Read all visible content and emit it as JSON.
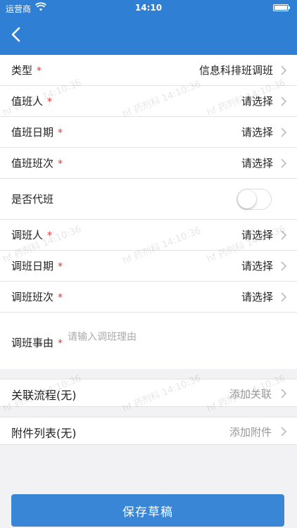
{
  "status_bar": {
    "carrier": "运营商",
    "time": "14:10"
  },
  "form": {
    "type": {
      "label": "类型",
      "required_mark": "*",
      "value": "信息科排班调班"
    },
    "duty_person": {
      "label": "值班人",
      "required_mark": "*",
      "value": "请选择"
    },
    "duty_date": {
      "label": "值班日期",
      "required_mark": "*",
      "value": "请选择"
    },
    "duty_shift": {
      "label": "值班班次",
      "required_mark": "*",
      "value": "请选择"
    },
    "substitute": {
      "label": "是否代班",
      "enabled": false
    },
    "swap_person": {
      "label": "调班人",
      "required_mark": "*",
      "value": "请选择"
    },
    "swap_date": {
      "label": "调班日期",
      "required_mark": "*",
      "value": "请选择"
    },
    "swap_shift": {
      "label": "调班班次",
      "required_mark": "*",
      "value": "请选择"
    },
    "reason": {
      "label": "调班事由",
      "required_mark": "*",
      "placeholder": "请输入调班理由",
      "value": ""
    }
  },
  "related_process": {
    "label": "关联流程(无)",
    "action": "添加关联"
  },
  "attachments": {
    "label": "附件列表(无)",
    "action": "添加附件"
  },
  "save_button": {
    "label": "保存草稿"
  },
  "watermark": "hf 药剂科 14:10:36",
  "colors": {
    "header": "#2f7fd5",
    "button": "#3a86d6",
    "required": "#e33333"
  }
}
